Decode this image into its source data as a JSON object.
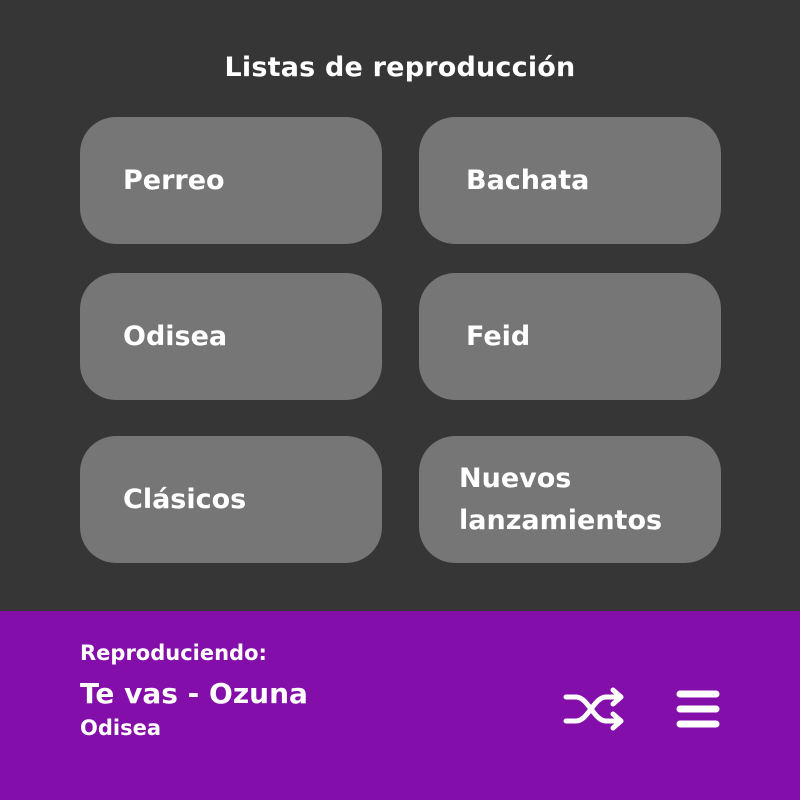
{
  "header": {
    "title": "Listas de reproducción"
  },
  "playlists": [
    {
      "label": "Perreo"
    },
    {
      "label": "Bachata"
    },
    {
      "label": "Odisea"
    },
    {
      "label": "Feid"
    },
    {
      "label": "Clásicos"
    },
    {
      "label": "Nuevos\nlanzamientos"
    }
  ],
  "player": {
    "now_playing_label": "Reproduciendo:",
    "track": "Te vas - Ozuna",
    "playlist": "Odisea",
    "shuffle_icon": "shuffle-icon",
    "menu_icon": "menu-icon"
  },
  "colors": {
    "background": "#363636",
    "card": "#767676",
    "player_bar": "#830ea9",
    "text": "#ffffff"
  }
}
